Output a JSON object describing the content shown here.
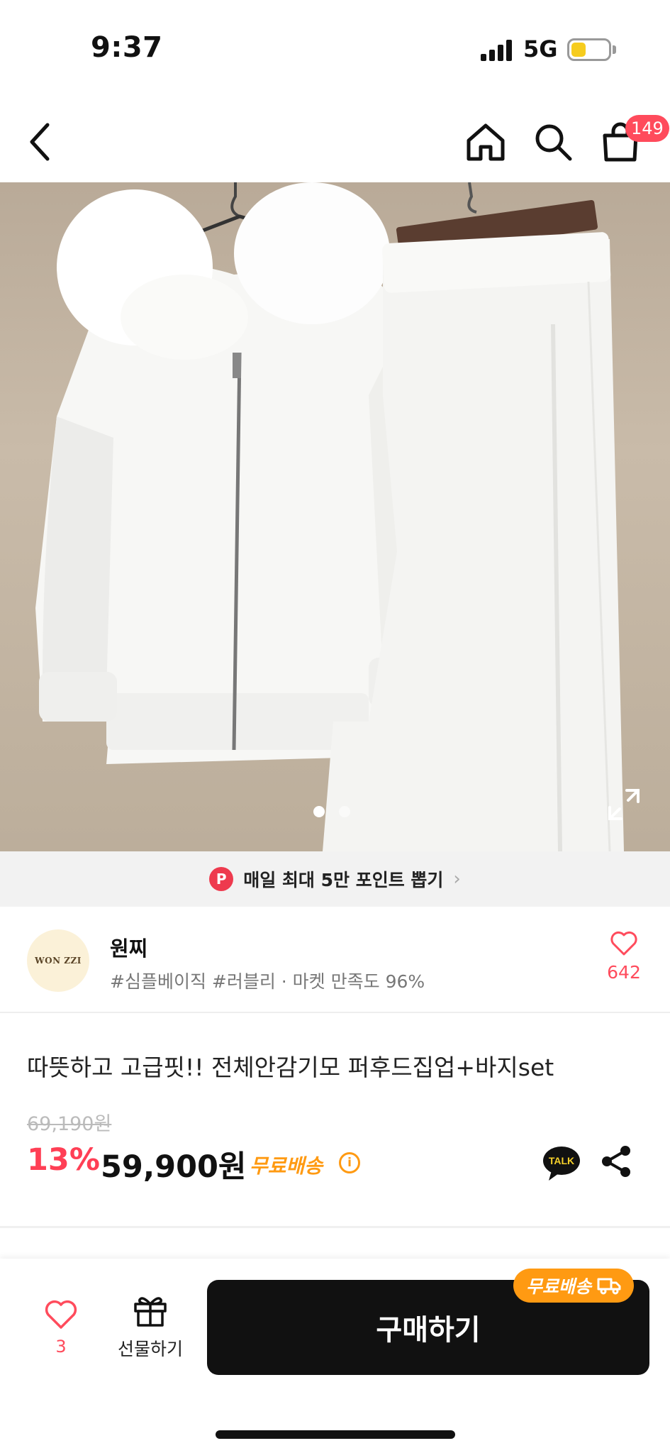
{
  "status_bar": {
    "time": "9:37",
    "network": "5G"
  },
  "nav": {
    "cart_count": "149"
  },
  "points_banner": {
    "badge": "P",
    "text": "매일 최대 5만 포인트 뽑기"
  },
  "store": {
    "logo_text": "WON ZZI",
    "name": "원찌",
    "tags": "#심플베이직 #러블리 · 마켓 만족도 96%",
    "likes": "642"
  },
  "product": {
    "title": "따뜻하고 고급핏!! 전체안감기모 퍼후드집업+바지set",
    "original_price": "69,190원",
    "discount": "13%",
    "price": "59,900원",
    "shipping": "무료배송",
    "info_mark": "i",
    "talk_label": "TALK"
  },
  "bottom_bar": {
    "fav_count": "3",
    "gift_label": "선물하기",
    "buy_label": "구매하기",
    "shipping_tag": "무료배송"
  },
  "colors": {
    "accent": "#ff4b5c",
    "shipping": "#ff9a12",
    "buy_bg": "#111111"
  }
}
